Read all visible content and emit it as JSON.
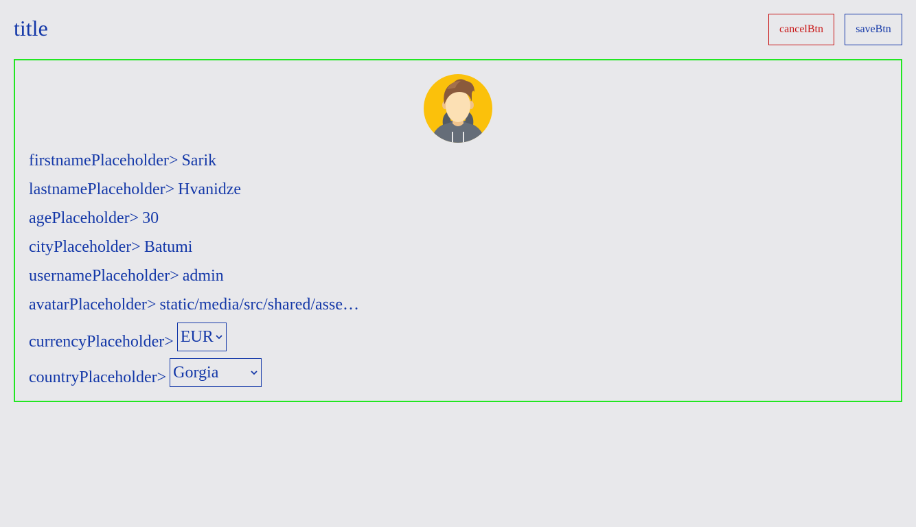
{
  "header": {
    "title": "title",
    "cancel_label": "cancelBtn",
    "save_label": "saveBtn"
  },
  "profile": {
    "avatar_icon": "avatar-user-icon",
    "fields": {
      "firstname": {
        "label": "firstnamePlaceholder>",
        "value": "Sarik"
      },
      "lastname": {
        "label": "lastnamePlaceholder>",
        "value": "Hvanidze"
      },
      "age": {
        "label": "agePlaceholder>",
        "value": "30"
      },
      "city": {
        "label": "cityPlaceholder>",
        "value": "Batumi"
      },
      "username": {
        "label": "usernamePlaceholder>",
        "value": "admin"
      },
      "avatar": {
        "label": "avatarPlaceholder>",
        "value": "static/media/src/shared/asse…"
      }
    },
    "currency": {
      "label": "currencyPlaceholder>",
      "selected": "EUR"
    },
    "country": {
      "label": "countryPlaceholder>",
      "selected": "Gorgia"
    }
  },
  "colors": {
    "text": "#1438a8",
    "cancel": "#c81414",
    "card_border": "#22e622",
    "background": "#e8e8eb",
    "avatar_bg": "#fbc10b"
  }
}
